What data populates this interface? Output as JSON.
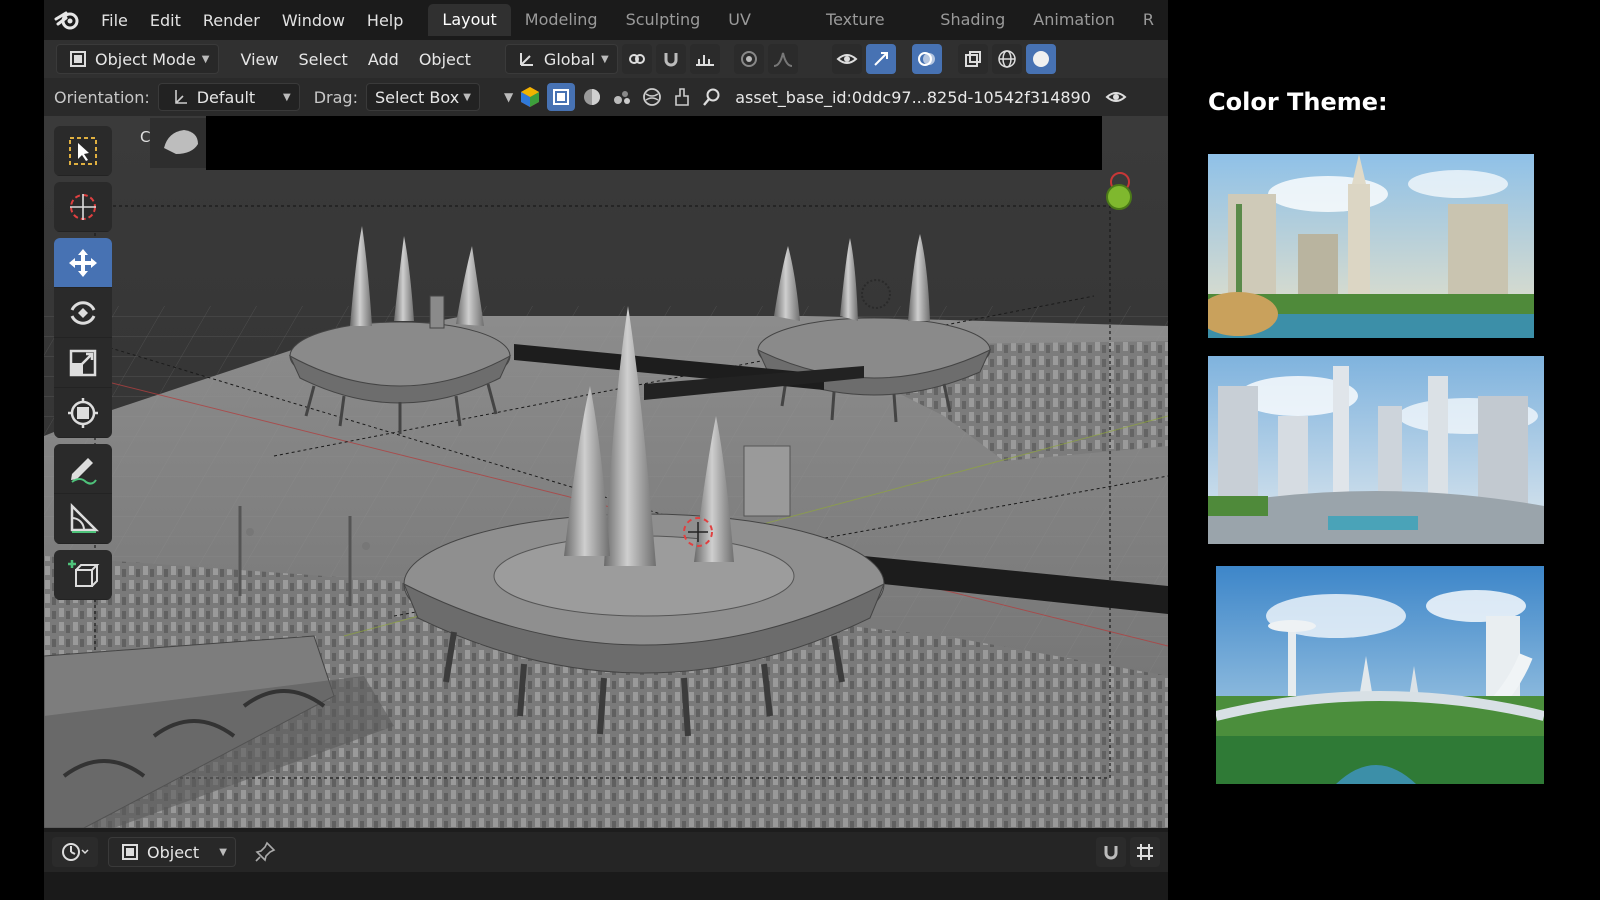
{
  "app": {
    "menu": [
      "File",
      "Edit",
      "Render",
      "Window",
      "Help"
    ],
    "workspace_tabs": [
      "Layout",
      "Modeling",
      "Sculpting",
      "UV Editing",
      "Texture Paint",
      "Shading",
      "Animation",
      "R"
    ],
    "active_tab": "Layout"
  },
  "header": {
    "mode": "Object Mode",
    "menus": [
      "View",
      "Select",
      "Add",
      "Object"
    ],
    "transform_orientation": "Global"
  },
  "tool_settings": {
    "orientation_label": "Orientation:",
    "orientation_value": "Default",
    "drag_label": "Drag:",
    "drag_value": "Select Box",
    "search_value": "asset_base_id:0ddc97...825d-10542f314890"
  },
  "viewport": {
    "overlay_text": "C"
  },
  "toolbar": {
    "tools": [
      "select-box",
      "cursor",
      "move",
      "rotate",
      "scale",
      "transform",
      "annotate",
      "measure",
      "add-cube"
    ],
    "active_tool": "move"
  },
  "bottom": {
    "mode_value": "Object"
  },
  "panel": {
    "title": "Color Theme:"
  },
  "colors": {
    "accent": "#4772b3",
    "header_bg": "#303030",
    "gizmo_red": "#c83737",
    "gizmo_green": "#7fb82e"
  }
}
